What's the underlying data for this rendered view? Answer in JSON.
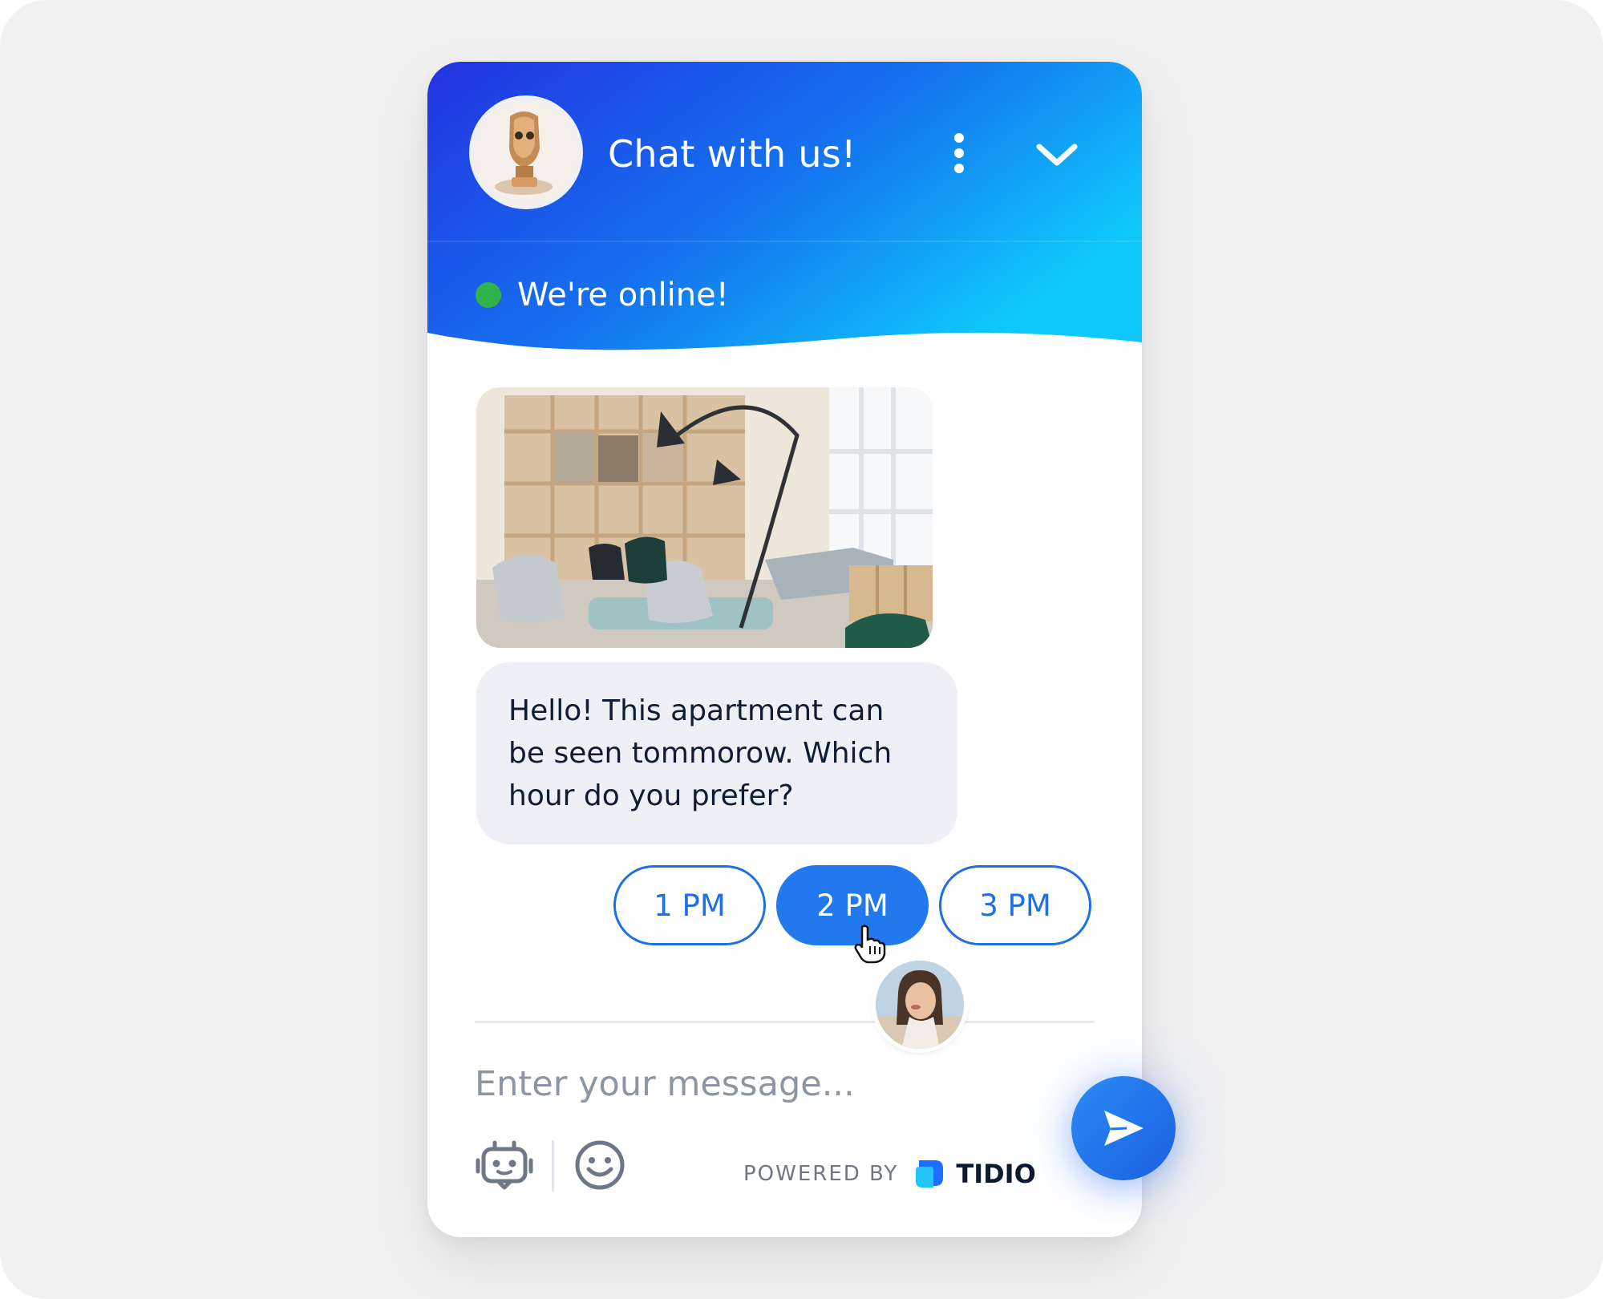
{
  "header": {
    "title": "Chat with us!",
    "status": "We're online!",
    "status_color": "#2fb34a",
    "gradient": [
      "#2333e3",
      "#0fc8fa"
    ]
  },
  "icons": {
    "menu": "vertical-dots-icon",
    "collapse": "chevron-down-icon",
    "bot": "bot-icon",
    "emoji": "smile-icon",
    "send": "paper-plane-icon",
    "cursor": "hand-pointer-icon"
  },
  "messages": [
    {
      "type": "image",
      "alt": "apartment living room photo"
    },
    {
      "type": "text",
      "text": "Hello! This apartment can be seen tommorow. Which hour do you prefer?"
    }
  ],
  "quick_replies": [
    {
      "label": "1 PM",
      "selected": false
    },
    {
      "label": "2 PM",
      "selected": true
    },
    {
      "label": "3 PM",
      "selected": false
    }
  ],
  "composer": {
    "placeholder": "Enter your message..."
  },
  "footer": {
    "powered_by": "POWERED BY",
    "brand": "TIDIO"
  },
  "colors": {
    "accent": "#2279ee",
    "bubble_bg": "#eef0f5",
    "text_dark": "#0f1c33"
  }
}
